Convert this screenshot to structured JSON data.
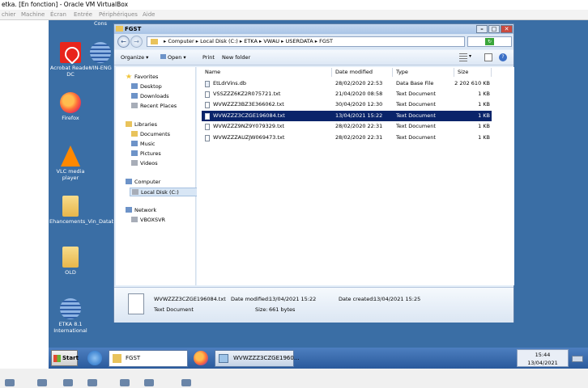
{
  "host": {
    "title": "etka. [En fonction] - Oracle VM VirtualBox",
    "menu": [
      "chier",
      "Machine",
      "Écran",
      "Entrée",
      "Périphériques",
      "Aide"
    ]
  },
  "desktop_icons": [
    {
      "label": "Acrobat Reader DC",
      "icon": "pdf-icon"
    },
    {
      "label": "VIN-ENG",
      "icon": "globe-icon"
    },
    {
      "label": "Firefox",
      "icon": "firefox-icon"
    },
    {
      "label": "VLC media player",
      "icon": "vlc-icon"
    },
    {
      "label": "Ehancements_Vin_Databa...",
      "icon": "folder-icon"
    },
    {
      "label": "OLD",
      "icon": "folder-icon"
    },
    {
      "label": "ETKA 8.1 International",
      "icon": "globe-icon"
    },
    {
      "label": "Cons",
      "icon": "text-fragment"
    }
  ],
  "window": {
    "title": "FGST",
    "address": [
      "Computer",
      "Local Disk (C:)",
      "ETKA",
      "VWAU",
      "USERDATA",
      "FGST"
    ],
    "toolbar": {
      "organize": "Organize ▾",
      "open": "Open ▾",
      "print": "Print",
      "new_folder": "New folder"
    }
  },
  "navigation": {
    "favorites": {
      "header": "Favorites",
      "items": [
        "Desktop",
        "Downloads",
        "Recent Places"
      ]
    },
    "libraries": {
      "header": "Libraries",
      "items": [
        "Documents",
        "Music",
        "Pictures",
        "Videos"
      ]
    },
    "computer": {
      "header": "Computer",
      "items": [
        "Local Disk (C:)"
      ]
    },
    "network": {
      "header": "Network",
      "items": [
        "VBOXSVR"
      ]
    }
  },
  "file_list": {
    "columns": [
      "Name",
      "Date modified",
      "Type",
      "Size"
    ],
    "rows": [
      {
        "name": "EtLdrVins.db",
        "date": "28/02/2020 22:53",
        "type": "Data Base File",
        "size": "2 202 610 KB"
      },
      {
        "name": "VSSZZZ6KZ2R075721.txt",
        "date": "21/04/2020 08:58",
        "type": "Text Document",
        "size": "1 KB"
      },
      {
        "name": "WVWZZZ3BZ3E366062.txt",
        "date": "30/04/2020 12:30",
        "type": "Text Document",
        "size": "1 KB"
      },
      {
        "name": "WVWZZZ3CZGE196084.txt",
        "date": "13/04/2021 15:22",
        "type": "Text Document",
        "size": "1 KB",
        "selected": true
      },
      {
        "name": "WVWZZZ9NZ9Y079329.txt",
        "date": "28/02/2020 22:31",
        "type": "Text Document",
        "size": "1 KB"
      },
      {
        "name": "WVWZZZAUZJW069473.txt",
        "date": "28/02/2020 22:31",
        "type": "Text Document",
        "size": "1 KB"
      }
    ]
  },
  "details": {
    "filename": "WVWZZZ3CZGE196084.txt",
    "type": "Text Document",
    "modified_label": "Date modified:",
    "modified": "13/04/2021 15:22",
    "created_label": "Date created:",
    "created": "13/04/2021 15:25",
    "size_label": "Size:",
    "size": "661 bytes"
  },
  "taskbar": {
    "start": "Start",
    "buttons": [
      "FGST",
      "WVWZZZ3CZGE1960..."
    ],
    "time": "15:44",
    "date": "13/04/2021"
  }
}
